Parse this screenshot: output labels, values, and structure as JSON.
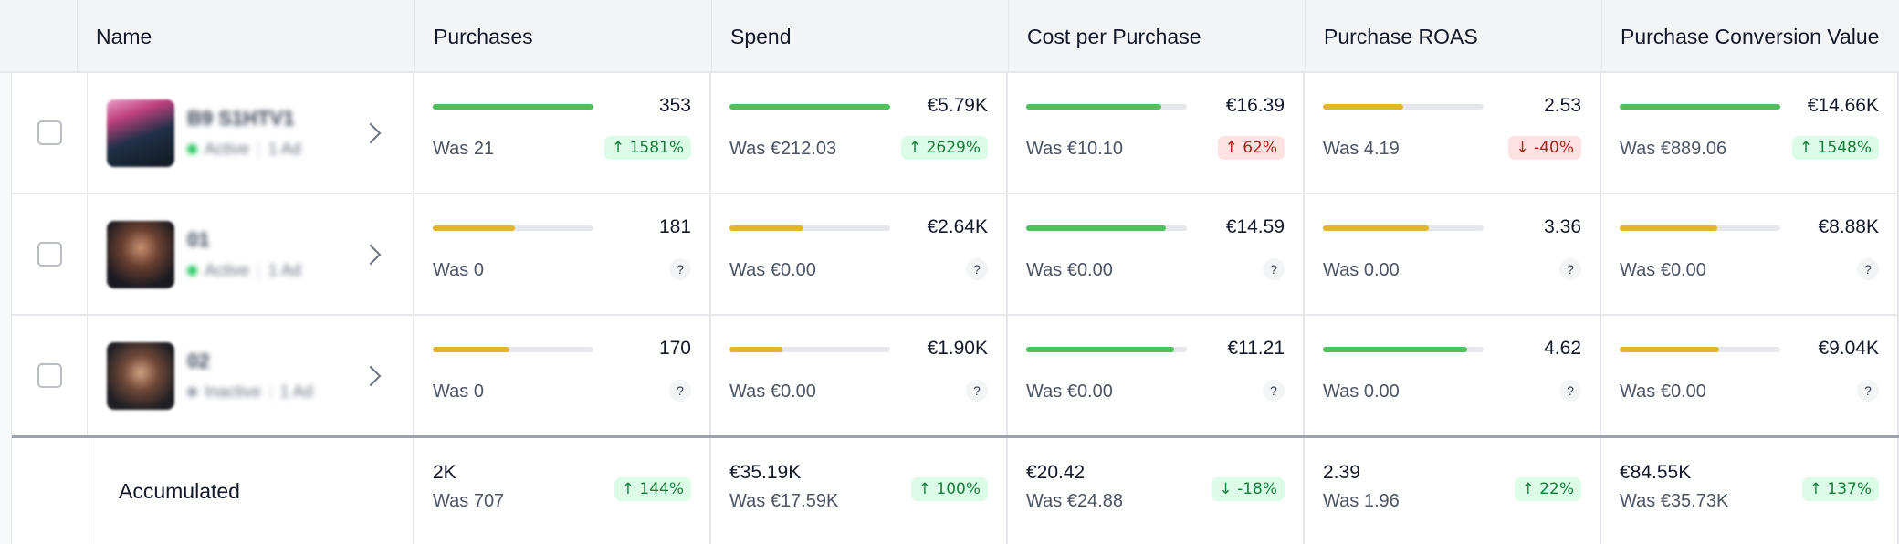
{
  "columns": {
    "name": "Name",
    "purchases": "Purchases",
    "spend": "Spend",
    "cost_per_purchase": "Cost per Purchase",
    "purchase_roas": "Purchase ROAS",
    "purchase_conversion_value": "Purchase Conversion Value"
  },
  "colors": {
    "green": "#4cc15c",
    "yellow": "#e3b52a",
    "track": "#e5e7eb",
    "active": "#22c55e",
    "inactive": "#9ca3af"
  },
  "rows": [
    {
      "name": "B9 S1HTV1",
      "status": "Active",
      "ads": "1 Ad",
      "metrics": [
        {
          "value": "353",
          "was": "Was 21",
          "delta": "↑ 1581%",
          "delta_type": "up",
          "bar": 1.0,
          "bar_color": "green"
        },
        {
          "value": "€5.79K",
          "was": "Was €212.03",
          "delta": "↑ 2629%",
          "delta_type": "up",
          "bar": 1.0,
          "bar_color": "green"
        },
        {
          "value": "€16.39",
          "was": "Was €10.10",
          "delta": "↑ 62%",
          "delta_type": "bad",
          "bar": 0.84,
          "bar_color": "green"
        },
        {
          "value": "2.53",
          "was": "Was 4.19",
          "delta": "↓ -40%",
          "delta_type": "bad",
          "bar": 0.5,
          "bar_color": "yellow"
        },
        {
          "value": "€14.66K",
          "was": "Was €889.06",
          "delta": "↑ 1548%",
          "delta_type": "up",
          "bar": 1.0,
          "bar_color": "green"
        }
      ]
    },
    {
      "name": "01",
      "status": "Active",
      "ads": "1 Ad",
      "metrics": [
        {
          "value": "181",
          "was": "Was 0",
          "delta": "?",
          "delta_type": "unknown",
          "bar": 0.51,
          "bar_color": "yellow"
        },
        {
          "value": "€2.64K",
          "was": "Was €0.00",
          "delta": "?",
          "delta_type": "unknown",
          "bar": 0.46,
          "bar_color": "yellow"
        },
        {
          "value": "€14.59",
          "was": "Was €0.00",
          "delta": "?",
          "delta_type": "unknown",
          "bar": 0.87,
          "bar_color": "green"
        },
        {
          "value": "3.36",
          "was": "Was 0.00",
          "delta": "?",
          "delta_type": "unknown",
          "bar": 0.66,
          "bar_color": "yellow"
        },
        {
          "value": "€8.88K",
          "was": "Was €0.00",
          "delta": "?",
          "delta_type": "unknown",
          "bar": 0.61,
          "bar_color": "yellow"
        }
      ]
    },
    {
      "name": "02",
      "status": "Inactive",
      "ads": "1 Ad",
      "metrics": [
        {
          "value": "170",
          "was": "Was 0",
          "delta": "?",
          "delta_type": "unknown",
          "bar": 0.48,
          "bar_color": "yellow"
        },
        {
          "value": "€1.90K",
          "was": "Was €0.00",
          "delta": "?",
          "delta_type": "unknown",
          "bar": 0.33,
          "bar_color": "yellow"
        },
        {
          "value": "€11.21",
          "was": "Was €0.00",
          "delta": "?",
          "delta_type": "unknown",
          "bar": 0.92,
          "bar_color": "green"
        },
        {
          "value": "4.62",
          "was": "Was 0.00",
          "delta": "?",
          "delta_type": "unknown",
          "bar": 0.9,
          "bar_color": "green"
        },
        {
          "value": "€9.04K",
          "was": "Was €0.00",
          "delta": "?",
          "delta_type": "unknown",
          "bar": 0.62,
          "bar_color": "yellow"
        }
      ]
    }
  ],
  "accumulated": {
    "label": "Accumulated",
    "metrics": [
      {
        "value": "2K",
        "was": "Was 707",
        "delta": "↑ 144%"
      },
      {
        "value": "€35.19K",
        "was": "Was €17.59K",
        "delta": "↑ 100%"
      },
      {
        "value": "€20.42",
        "was": "Was €24.88",
        "delta": "↓ -18%"
      },
      {
        "value": "2.39",
        "was": "Was 1.96",
        "delta": "↑ 22%"
      },
      {
        "value": "€84.55K",
        "was": "Was €35.73K",
        "delta": "↑ 137%"
      }
    ]
  }
}
